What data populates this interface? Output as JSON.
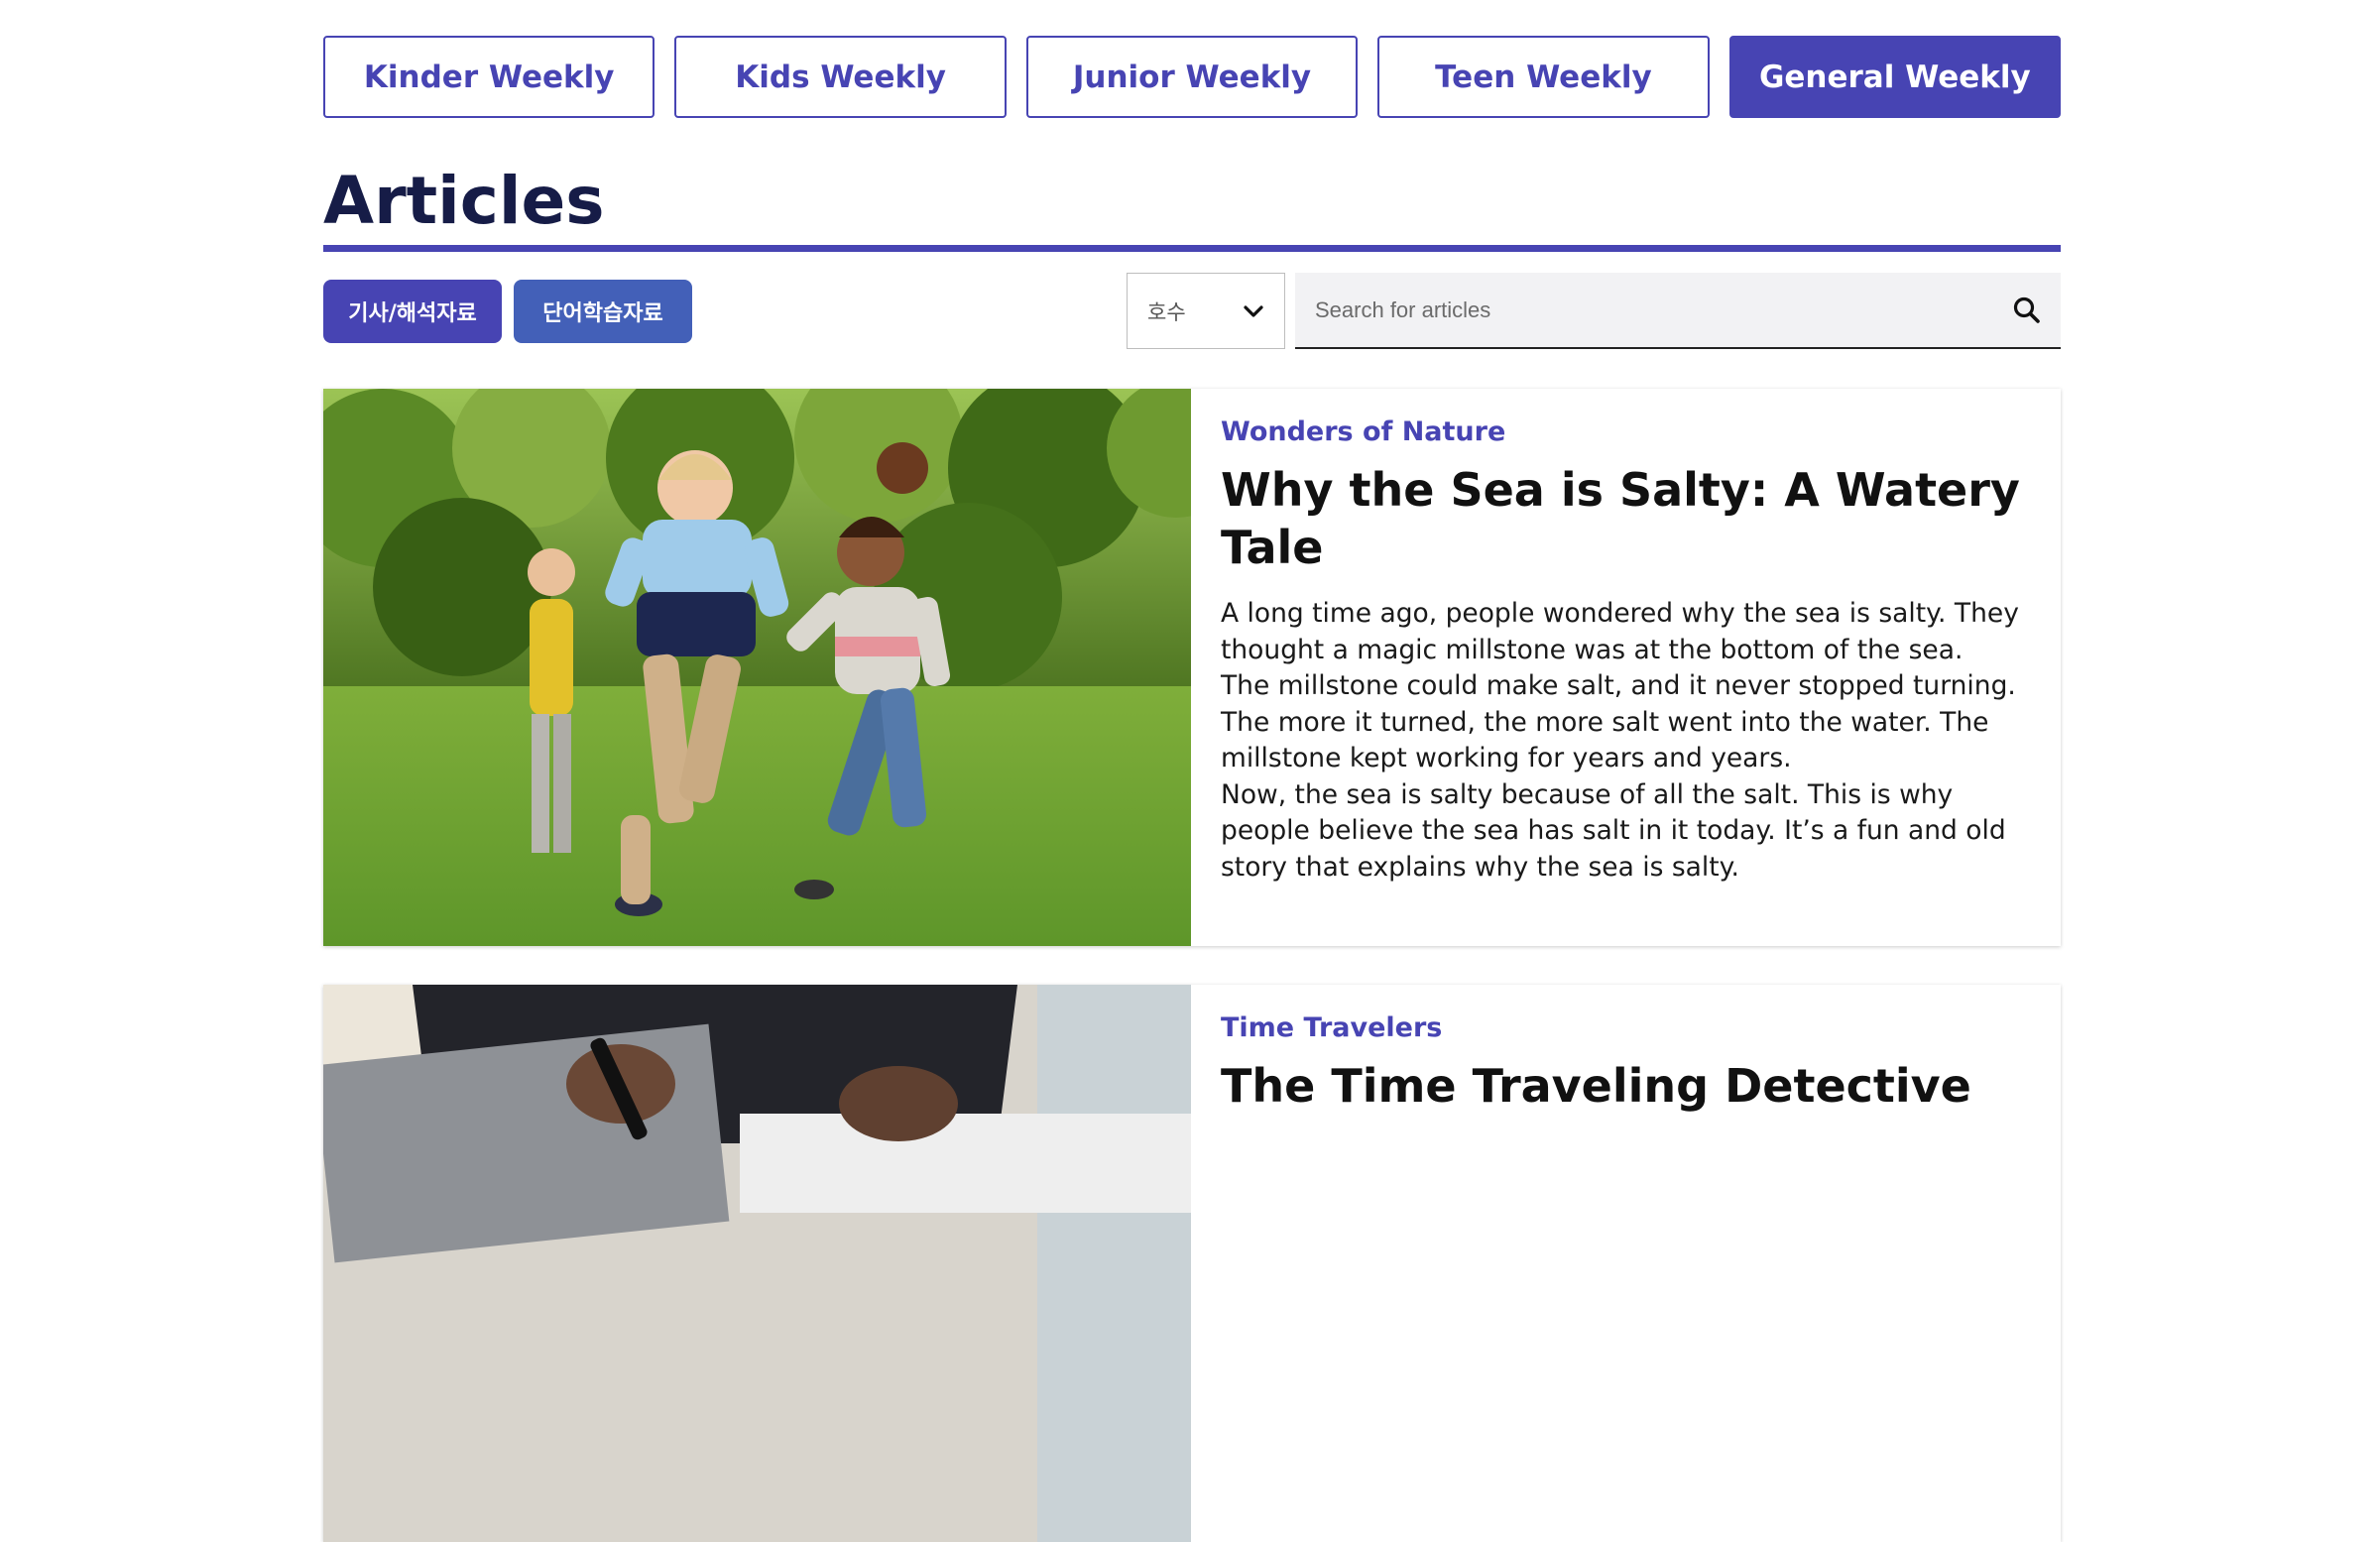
{
  "level_tabs": [
    {
      "label": "Kinder Weekly",
      "active": false
    },
    {
      "label": "Kids Weekly",
      "active": false
    },
    {
      "label": "Junior Weekly",
      "active": false
    },
    {
      "label": "Teen Weekly",
      "active": false
    },
    {
      "label": "General Weekly",
      "active": true
    }
  ],
  "page": {
    "title": "Articles"
  },
  "filters": {
    "articles_button": "기사/해석자료",
    "vocab_button": "단어학습자료",
    "issue_select": "호수",
    "search_placeholder": "Search for articles"
  },
  "articles": [
    {
      "category": "Wonders of Nature",
      "title": "Why the Sea is Salty: A Watery Tale",
      "summary": "A long time ago, people wondered why the sea is salty. They thought a magic millstone was at the bottom of the sea.\nThe millstone could make salt, and it never stopped turning. The more it turned, the more salt went into the water. The millstone kept working for years and years.\nNow, the sea is salty because of all the salt. This is why people believe the sea has salt in it today. It’s a fun and old story that explains why the sea is salty."
    },
    {
      "category": "Time Travelers",
      "title": "The Time Traveling Detective",
      "summary": ""
    }
  ],
  "colors": {
    "accent": "#4744b3",
    "title": "#161c47",
    "vocab_button": "#4360b8"
  }
}
